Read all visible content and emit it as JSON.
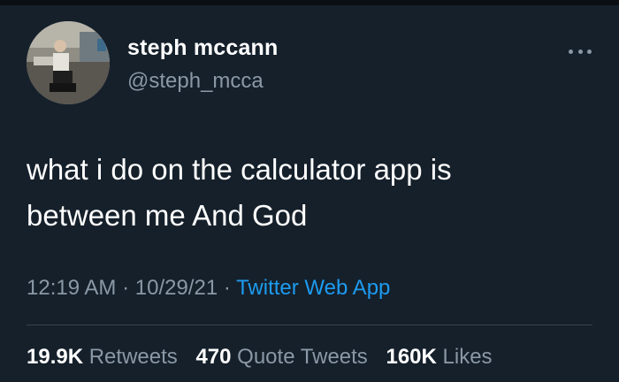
{
  "tweet": {
    "author": {
      "display_name": "steph mccann",
      "handle": "@steph_mcca"
    },
    "text_line1": "what i do on the calculator app is",
    "text_line2": "between me And God",
    "time": "12:19 AM",
    "date": "10/29/21",
    "separator": "·",
    "source": "Twitter Web App",
    "stats": {
      "retweets": {
        "count": "19.9K",
        "label": "Retweets"
      },
      "quotes": {
        "count": "470",
        "label": "Quote Tweets"
      },
      "likes": {
        "count": "160K",
        "label": "Likes"
      }
    }
  },
  "icons": {
    "more": "more-horizontal-icon"
  },
  "colors": {
    "background": "#15202b",
    "secondary_text": "#8b98a5",
    "link": "#1d9bf0",
    "divider": "#38444d"
  }
}
